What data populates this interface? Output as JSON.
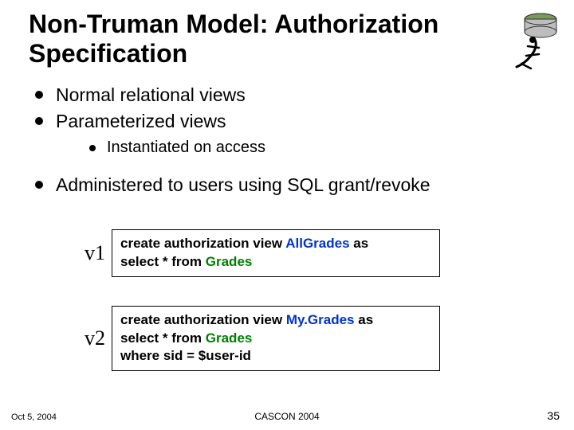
{
  "title": "Non-Truman Model: Authorization Specification",
  "bullets": {
    "b0": "Normal relational views",
    "b1": "Parameterized views",
    "b1_sub0": "Instantiated on access",
    "b2": "Administered to users using SQL grant/revoke"
  },
  "views": {
    "v1": {
      "label": "v1",
      "sql": {
        "l1_pre": "create authorization view ",
        "l1_name": "AllGrades",
        "l1_post": " as",
        "l2_pre": "select * from ",
        "l2_rel": "Grades"
      }
    },
    "v2": {
      "label": "v2",
      "sql": {
        "l1_pre": "create authorization view ",
        "l1_name": "My.Grades",
        "l1_post": " as",
        "l2_pre": "select * from ",
        "l2_rel": "Grades",
        "l3": "where sid = $user-id"
      }
    }
  },
  "footer": {
    "date": "Oct 5, 2004",
    "center": "CASCON 2004",
    "page": "35"
  }
}
